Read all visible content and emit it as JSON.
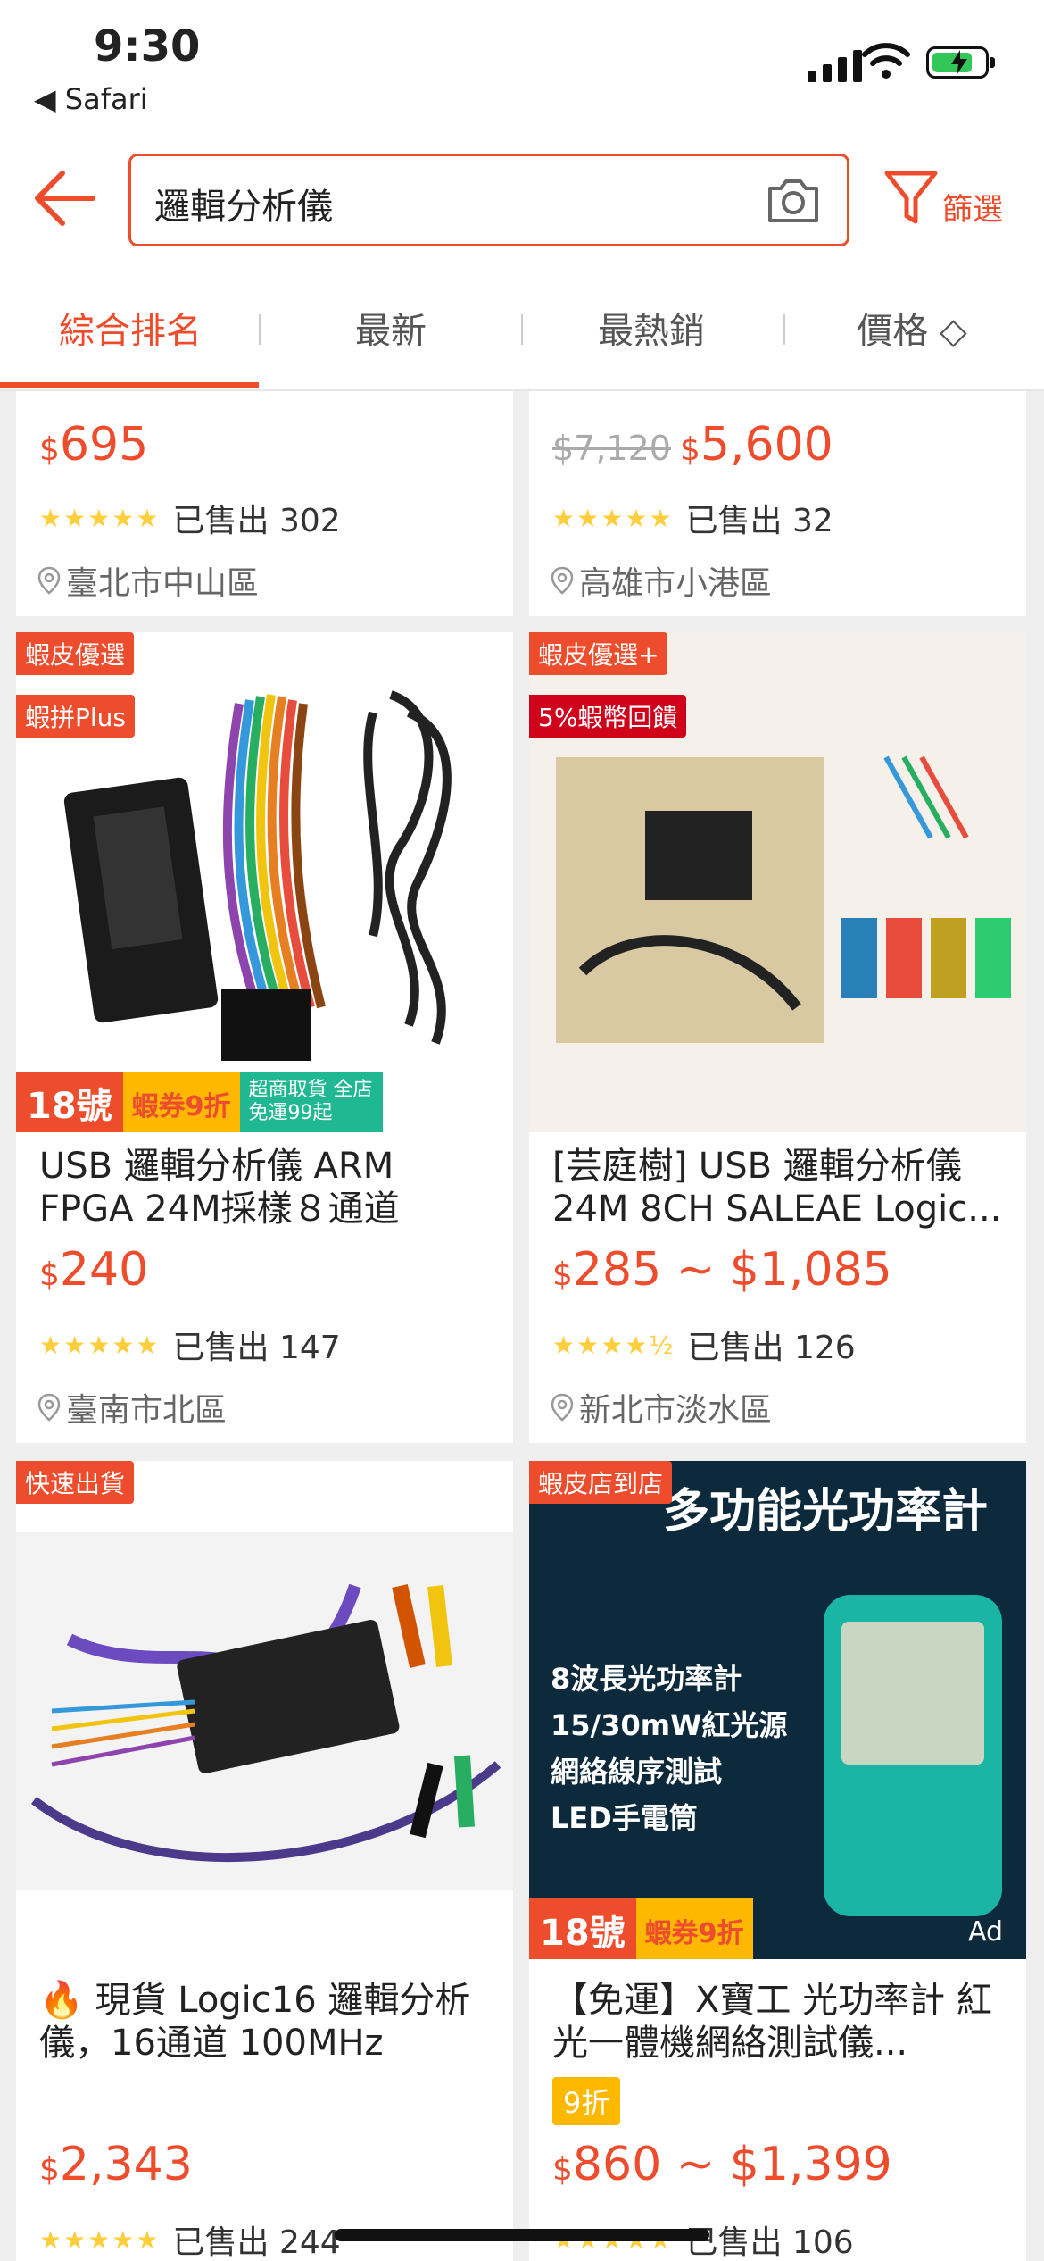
{
  "status_bar": {
    "time": "9:30",
    "back_app": "◀ Safari"
  },
  "header": {
    "search_query": "邏輯分析儀",
    "filter_label": "篩選"
  },
  "tabs": [
    {
      "label": "綜合排名",
      "active": true
    },
    {
      "label": "最新",
      "active": false
    },
    {
      "label": "最熱銷",
      "active": false
    },
    {
      "label": "價格 ◇",
      "active": false
    }
  ],
  "products": [
    {
      "name": "",
      "price_display": "695",
      "currency": "$",
      "rating_stars": "★★★★★",
      "sold": "已售出 302",
      "location": "臺北市中山區"
    },
    {
      "name": "",
      "original_price": "$7,120",
      "price_display": "5,600",
      "currency": "$",
      "rating_stars": "★★★★★",
      "sold": "已售出 32",
      "location": "高雄市小港區"
    },
    {
      "name": "USB 邏輯分析儀 ARM FPGA 24M採樣８通道",
      "price_display": "240",
      "currency": "$",
      "rating_stars": "★★★★★",
      "sold": "已售出 147",
      "location": "臺南市北區",
      "badges": [
        "蝦皮優選",
        "蝦拼Plus"
      ],
      "promo": {
        "day": "18號",
        "coupon": "蝦券9折",
        "shipping": "超商取貨 全店免運99起"
      }
    },
    {
      "name": "[芸庭樹] USB 邏輯分析儀 24M 8CH SALEAE Logic...",
      "price_display": "285 ~ $1,085",
      "currency": "$",
      "rating_stars": "★★★★½",
      "sold": "已售出 126",
      "location": "新北市淡水區",
      "badges": [
        "蝦皮優選+",
        "5%蝦幣回饋"
      ]
    },
    {
      "name": "🔥 現貨 Logic16 邏輯分析儀，16通道 100MHz",
      "price_display": "2,343",
      "currency": "$",
      "rating_stars": "★★★★★",
      "sold": "已售出 244",
      "badges": [
        "快速出貨"
      ]
    },
    {
      "name": "【免運】X寶工 光功率計 紅光一體機網絡測試儀...",
      "discount": "9折",
      "price_display": "860 ~ $1,399",
      "currency": "$",
      "rating_stars": "★★★★★",
      "sold": "已售出 106",
      "badges": [
        "蝦皮店到店"
      ],
      "promo": {
        "day": "18號",
        "coupon": "蝦券9折"
      },
      "ad": "Ad",
      "image_text": {
        "banner": "多功能光功率計",
        "lines": [
          "8波長光功率計",
          "15/30mW紅光源",
          "網絡線序測試",
          "LED手電筒"
        ]
      }
    }
  ],
  "colors": {
    "accent": "#ee4d2d",
    "star": "#ffce3d"
  }
}
